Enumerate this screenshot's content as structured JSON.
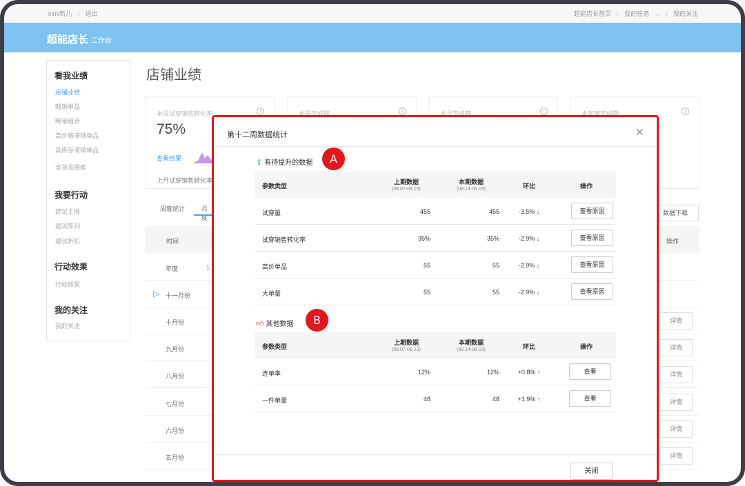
{
  "topbar": {
    "user": "kimi新儿",
    "logout": "退出",
    "home": "超能店长首页",
    "tasks": "我的任务",
    "follow": "我的关注"
  },
  "header": {
    "brand": "超能店长",
    "sub": "工作台"
  },
  "sidebar": {
    "groups": [
      {
        "title": "看我业绩",
        "items": [
          "店铺业绩",
          "畅销单品",
          "畅销组合",
          "高价格滞销单品",
          "高库存滞销单品",
          "全货品搜索"
        ]
      },
      {
        "title": "我要行动",
        "items": [
          "建议主推",
          "建议陈列",
          "建议折扣"
        ]
      },
      {
        "title": "行动效果",
        "items": [
          "行动效果"
        ]
      },
      {
        "title": "我的关注",
        "items": [
          "我的关注"
        ]
      }
    ]
  },
  "main": {
    "title": "店铺业绩",
    "cards": [
      {
        "label": "本周试穿销售转化率",
        "value": "75%",
        "link": "查看结果",
        "foot": "上月试穿销售转化率"
      },
      {
        "label": "本周完成额"
      },
      {
        "label": "本月完成额"
      },
      {
        "label": "本年度完成额"
      }
    ],
    "tabs": [
      "周度统计",
      "月度"
    ],
    "download": "数据下载",
    "table_head": {
      "time": "时间",
      "op": "操作"
    },
    "rows": [
      {
        "month": "年度",
        "num": "1"
      },
      {
        "month": "十一月份"
      },
      {
        "month": "十月份",
        "detail": "详情"
      },
      {
        "month": "九月份",
        "detail": "详情"
      },
      {
        "month": "八月份",
        "detail": "详情"
      },
      {
        "month": "七月份",
        "detail": "详情"
      },
      {
        "month": "六月份",
        "detail": "详情"
      },
      {
        "month": "五月份",
        "detail": "详情"
      }
    ]
  },
  "modal": {
    "title": "第十二周数据统计",
    "close_label": "关闭",
    "columns": {
      "name": "参数类型",
      "prev": "上期数据",
      "prev_range": "(08.07-08.13)",
      "cur": "本期数据",
      "cur_range": "(08.14-08.19)",
      "chg": "环比",
      "op": "操作"
    },
    "section_a": {
      "title": "有待提升的数据",
      "marker": "A",
      "rows": [
        {
          "name": "试穿量",
          "prev": "455",
          "cur": "455",
          "chg": "-3.5% ↓",
          "op": "查看原因"
        },
        {
          "name": "试穿销售转化率",
          "prev": "35%",
          "cur": "35%",
          "chg": "-2.9% ↓",
          "op": "查看原因"
        },
        {
          "name": "高价单品",
          "prev": "55",
          "cur": "55",
          "chg": "-2.9% ↓",
          "op": "查看原因"
        },
        {
          "name": "大单量",
          "prev": "55",
          "cur": "55",
          "chg": "-2.9% ↓",
          "op": "查看原因"
        }
      ]
    },
    "section_b": {
      "title": "其他数据",
      "marker": "B",
      "rows": [
        {
          "name": "连单率",
          "prev": "12%",
          "cur": "12%",
          "chg": "+0.8% ↑",
          "op": "查看"
        },
        {
          "name": "一件单量",
          "prev": "48",
          "cur": "48",
          "chg": "+1.9% ↑",
          "op": "查看"
        }
      ]
    },
    "colors": {
      "down": "#1fb05b",
      "up": "#e3161b",
      "highlight": "#e3161b"
    }
  }
}
